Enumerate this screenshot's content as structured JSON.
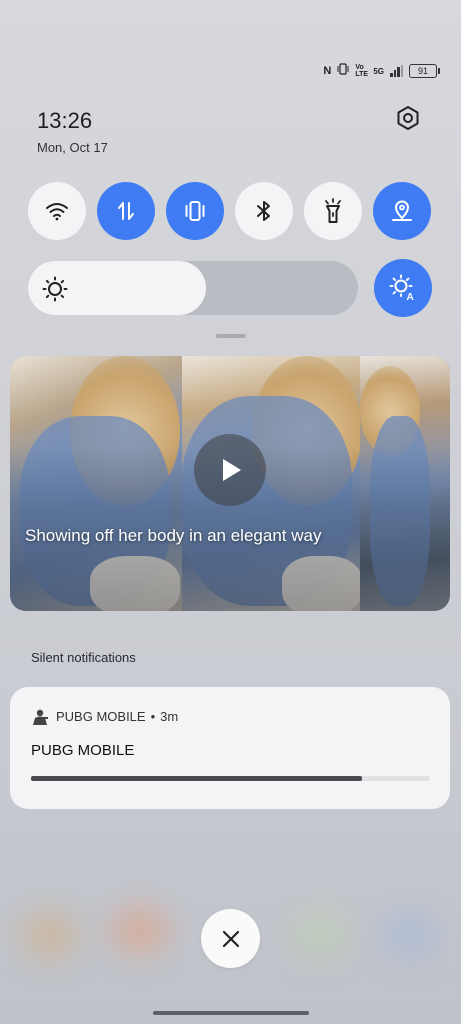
{
  "status_bar": {
    "nfc": "N",
    "volte": "Vo LTE",
    "network": "5G",
    "battery": "91",
    "icons": [
      "nfc-icon",
      "vibrate-icon",
      "volte-icon",
      "5g-icon",
      "signal-icon",
      "battery-icon"
    ]
  },
  "clock": {
    "time": "13:26",
    "date": "Mon, Oct 17"
  },
  "quick_tiles": [
    {
      "name": "wifi",
      "icon": "wifi-icon",
      "active": false
    },
    {
      "name": "mobile-data",
      "icon": "data-arrows-icon",
      "active": true
    },
    {
      "name": "vibrate",
      "icon": "vibrate-icon",
      "active": true
    },
    {
      "name": "bluetooth",
      "icon": "bluetooth-icon",
      "active": false
    },
    {
      "name": "flashlight",
      "icon": "flashlight-icon",
      "active": false
    },
    {
      "name": "location",
      "icon": "location-icon",
      "active": true
    }
  ],
  "brightness": {
    "level": 0.54,
    "auto": "A"
  },
  "media": {
    "title": "Showing off her body in an elegant way",
    "play_icon": "play-icon"
  },
  "notifications": {
    "section_label": "Silent notifications",
    "items": [
      {
        "app_name": "PUBG MOBILE",
        "separator": "•",
        "time_ago": "3m",
        "title": "PUBG MOBILE",
        "progress": 0.83
      }
    ]
  },
  "colors": {
    "accent": "#3f7cf4",
    "tile_off": "#f4f4f6"
  }
}
